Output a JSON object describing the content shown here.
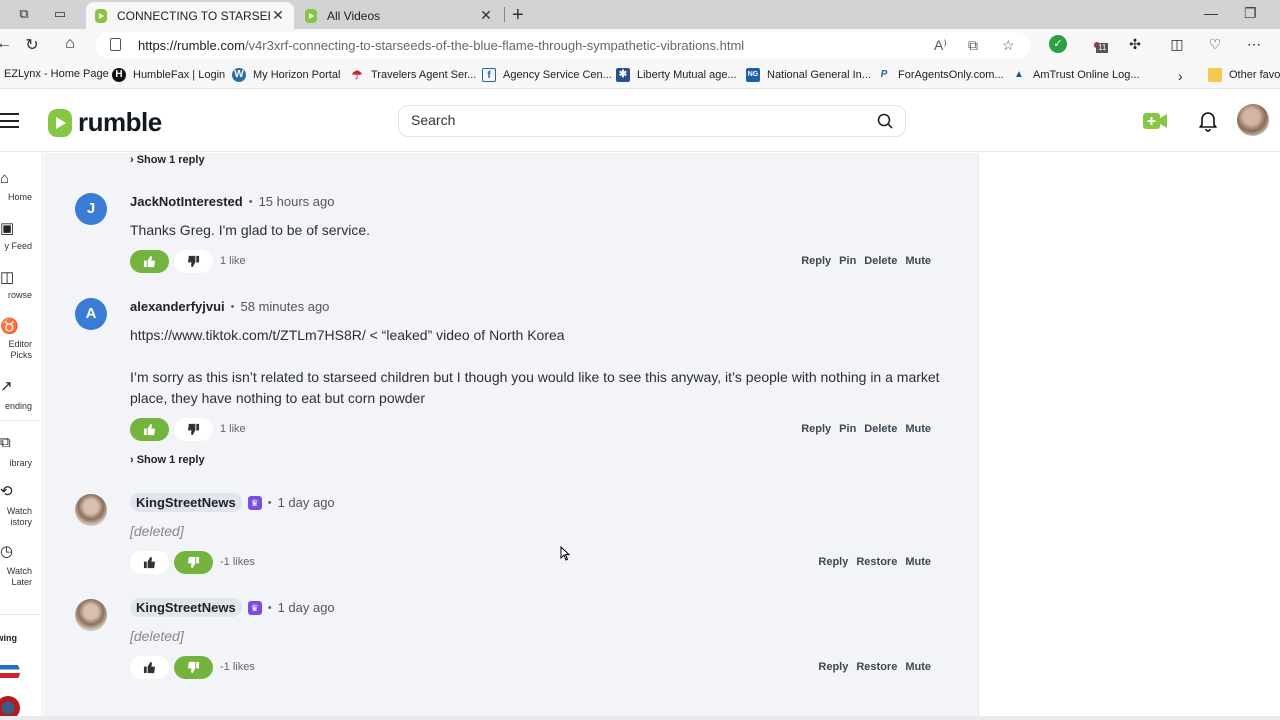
{
  "browser": {
    "tabs": [
      {
        "title": "CONNECTING TO STARSEEDS OF",
        "active": true
      },
      {
        "title": "All Videos",
        "active": false
      }
    ],
    "url_domain": "https://rumble.com",
    "url_path": "/v4r3xrf-connecting-to-starseeds-of-the-blue-flame-through-sympathetic-vibrations.html",
    "extension_badge": "11",
    "favorites": [
      {
        "label": "EZLynx - Home Page",
        "icon": "none"
      },
      {
        "label": "HumbleFax | Login",
        "icon": "humblefax-icon"
      },
      {
        "label": "My Horizon Portal",
        "icon": "wordpress-icon"
      },
      {
        "label": "Travelers Agent Ser...",
        "icon": "umbrella-icon"
      },
      {
        "label": "Agency Service Cen...",
        "icon": "facebook-icon"
      },
      {
        "label": "Liberty Mutual age...",
        "icon": "liberty-icon"
      },
      {
        "label": "National General In...",
        "icon": "ng-icon"
      },
      {
        "label": "ForAgentsOnly.com...",
        "icon": "foragents-icon"
      },
      {
        "label": "AmTrust Online Log...",
        "icon": "amtrust-icon"
      }
    ],
    "other_favorites": "Other favor"
  },
  "header": {
    "logo_text": "rumble",
    "search_placeholder": "Search"
  },
  "sidebar": {
    "items": [
      {
        "label": "Home",
        "icon": "home-icon"
      },
      {
        "label": "y Feed",
        "icon": "feed-icon"
      },
      {
        "label": "rowse",
        "icon": "browse-icon"
      },
      {
        "label": "Editor\nPicks",
        "icon": "award-icon"
      },
      {
        "label": "ending",
        "icon": "trending-icon"
      },
      {
        "label": "ibrary",
        "icon": "library-icon"
      },
      {
        "label": "Watch\nistory",
        "icon": "history-icon"
      },
      {
        "label": "Watch\nLater",
        "icon": "clock-icon"
      }
    ],
    "following_label": "llowing"
  },
  "comments": {
    "top_show_reply": "› Show 1 reply",
    "items": [
      {
        "avatar_letter": "J",
        "username": "JackNotInterested",
        "time": "15 hours ago",
        "body": "Thanks Greg. I'm glad to be of service.",
        "vote_state": "up",
        "likes": "1 like",
        "actions": [
          "Reply",
          "Pin",
          "Delete",
          "Mute"
        ]
      },
      {
        "avatar_letter": "A",
        "username": "alexanderfyjvui",
        "time": "58 minutes ago",
        "body_line1": "https://www.tiktok.com/t/ZTLm7HS8R/ < “leaked” video of North Korea",
        "body_line2": "I’m sorry as this isn’t related to starseed children but I though you would like to see this anyway, it’s people with nothing in a market place, they have nothing to eat but corn powder",
        "vote_state": "up",
        "likes": "1 like",
        "actions": [
          "Reply",
          "Pin",
          "Delete",
          "Mute"
        ],
        "show_reply": "› Show 1 reply"
      },
      {
        "username": "KingStreetNews",
        "time": "1 day ago",
        "body": "[deleted]",
        "vote_state": "down",
        "likes": "-1 likes",
        "actions": [
          "Reply",
          "Restore",
          "Mute"
        ]
      },
      {
        "username": "KingStreetNews",
        "time": "1 day ago",
        "body": "[deleted]",
        "vote_state": "down",
        "likes": "-1 likes",
        "actions": [
          "Reply",
          "Restore",
          "Mute"
        ]
      }
    ]
  },
  "colors": {
    "brand_green": "#85c742",
    "vote_active": "#73b33e",
    "avatar_blue": "#3a7bd5",
    "premium_badge": "#7a4fe0"
  }
}
